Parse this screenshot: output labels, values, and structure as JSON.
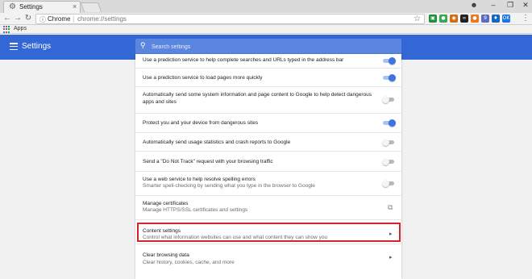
{
  "tab": {
    "title": "Settings",
    "favicon": "gear-icon",
    "close": "×"
  },
  "window_controls": {
    "minimize": "–",
    "maximize": "❐",
    "close": "✕",
    "profile": "person-icon"
  },
  "omnibox": {
    "scheme": "Chrome",
    "url": "chrome://settings",
    "info_icon": "info-icon",
    "bookmark_icon": "star-icon"
  },
  "extensions": [
    {
      "name": "android-icon",
      "color": "#1e8e3e",
      "glyph": "▣"
    },
    {
      "name": "green-circle-icon",
      "color": "#36a852",
      "glyph": "●"
    },
    {
      "name": "camera-icon",
      "color": "#d36b15",
      "glyph": "◉"
    },
    {
      "name": "glasses-icon",
      "color": "#222222",
      "glyph": "∞"
    },
    {
      "name": "orange-circle-icon",
      "color": "#e87722",
      "glyph": "●"
    },
    {
      "name": "nine-icon",
      "color": "#5c6bc0",
      "glyph": "9"
    },
    {
      "name": "blue-shield-icon",
      "color": "#1565c0",
      "glyph": "♦"
    },
    {
      "name": "ok-icon",
      "color": "#1a73e8",
      "glyph": "OK"
    }
  ],
  "bookmarks": {
    "apps_label": "Apps"
  },
  "appbar": {
    "title": "Settings"
  },
  "search": {
    "placeholder": "Search settings"
  },
  "settings": [
    {
      "label": "Use a prediction service to help complete searches and URLs typed in the address bar",
      "toggle": true
    },
    {
      "label": "Use a prediction service to load pages more quickly",
      "toggle": true
    },
    {
      "label": "Automatically send some system information and page content to Google to help detect dangerous apps and sites",
      "toggle": false
    },
    {
      "label": "Protect you and your device from dangerous sites",
      "toggle": true
    },
    {
      "label": "Automatically send usage statistics and crash reports to Google",
      "toggle": false
    },
    {
      "label": "Send a \"Do Not Track\" request with your browsing traffic",
      "toggle": false
    },
    {
      "label": "Use a web service to help resolve spelling errors",
      "sub": "Smarter spell-checking by sending what you type in the browser to Google",
      "toggle": false
    },
    {
      "label": "Manage certificates",
      "sub": "Manage HTTPS/SSL certificates and settings",
      "action": "external-link-icon"
    },
    {
      "label": "Content settings",
      "sub": "Control what information websites can use and what content they can show you",
      "action": "chevron-right-icon"
    },
    {
      "label": "Clear browsing data",
      "sub": "Clear history, cookies, cache, and more",
      "action": "chevron-right-icon"
    }
  ],
  "colors": {
    "accent": "#3367d6",
    "highlight": "#d4232a",
    "toggle_on": "#3e74e0"
  }
}
